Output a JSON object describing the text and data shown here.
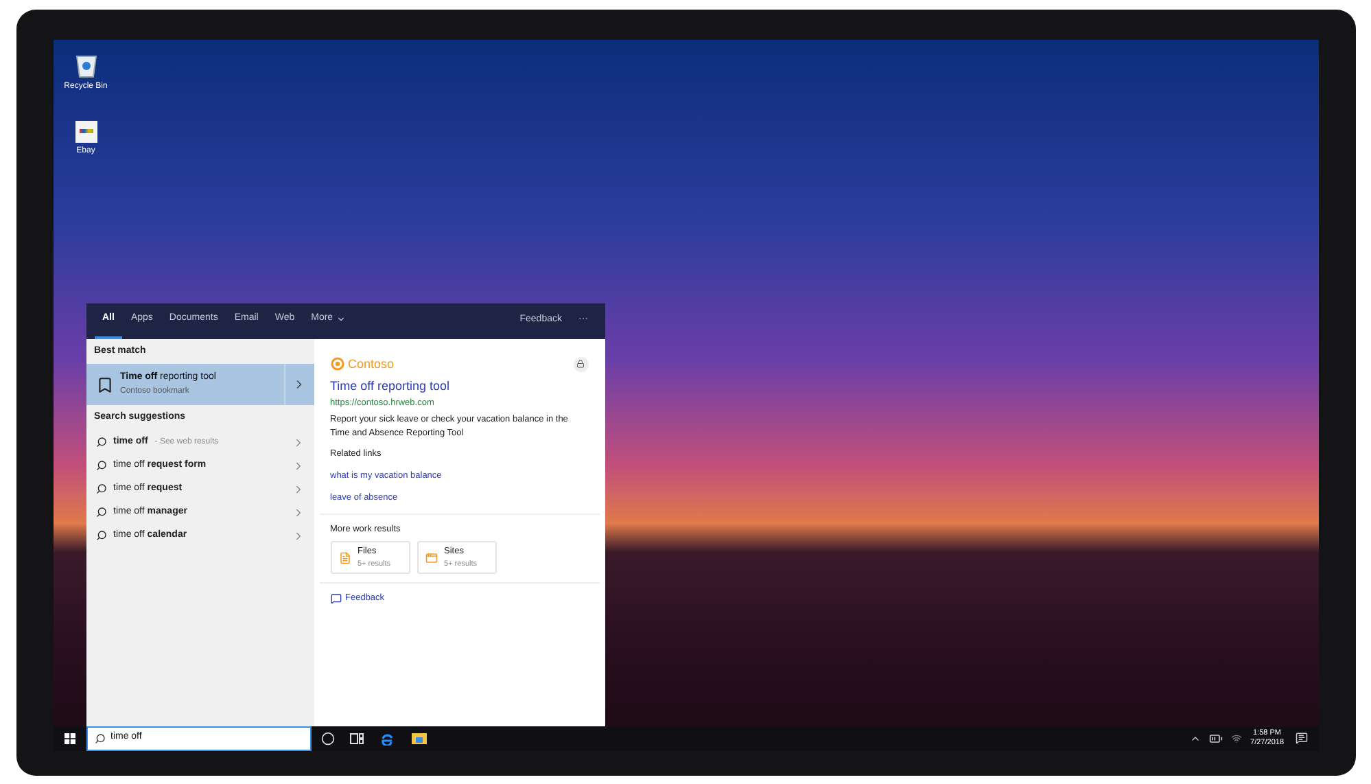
{
  "desktop_icons": [
    {
      "label": "Recycle Bin",
      "kind": "bin"
    },
    {
      "label": "Ebay",
      "kind": "store"
    }
  ],
  "search_panel": {
    "tabs": [
      {
        "label": "All",
        "selected": true
      },
      {
        "label": "Apps",
        "selected": false
      },
      {
        "label": "Documents",
        "selected": false
      },
      {
        "label": "Email",
        "selected": false
      },
      {
        "label": "Web",
        "selected": false
      },
      {
        "label": "More",
        "selected": false
      }
    ],
    "feedback": "Feedback",
    "more_options": "···",
    "best_match": {
      "heading": "Best match",
      "title": "**Time off** reporting tool",
      "subtitle": "Contoso bookmark",
      "selected": true
    },
    "suggestions_heading": "Search suggestions",
    "suggestions": [
      {
        "text": "**time off**",
        "note": "- See web results"
      },
      {
        "text": "time off **request form**"
      },
      {
        "text": "time off **request**"
      },
      {
        "text": "time off **manager**"
      },
      {
        "text": "time off **calendar**"
      }
    ],
    "preview": {
      "brand": "Contoso",
      "title": "Time off reporting tool",
      "url": "https://contoso.hrweb.com",
      "description": "Report your sick leave or check your vacation balance in the Time and Absence Reporting Tool",
      "related_heading": "Related links",
      "related_links": [
        "what is my vacation balance",
        "leave of absence"
      ],
      "more_heading": "More work results",
      "more_results": [
        {
          "kind": "files",
          "label": "Files",
          "count": "5+ results"
        },
        {
          "kind": "sites",
          "label": "Sites",
          "count": "5+ results"
        }
      ],
      "feedback": "Feedback"
    }
  },
  "taskbar": {
    "search_value": "time off",
    "time": "1:58 PM",
    "date": "7/27/2018"
  }
}
